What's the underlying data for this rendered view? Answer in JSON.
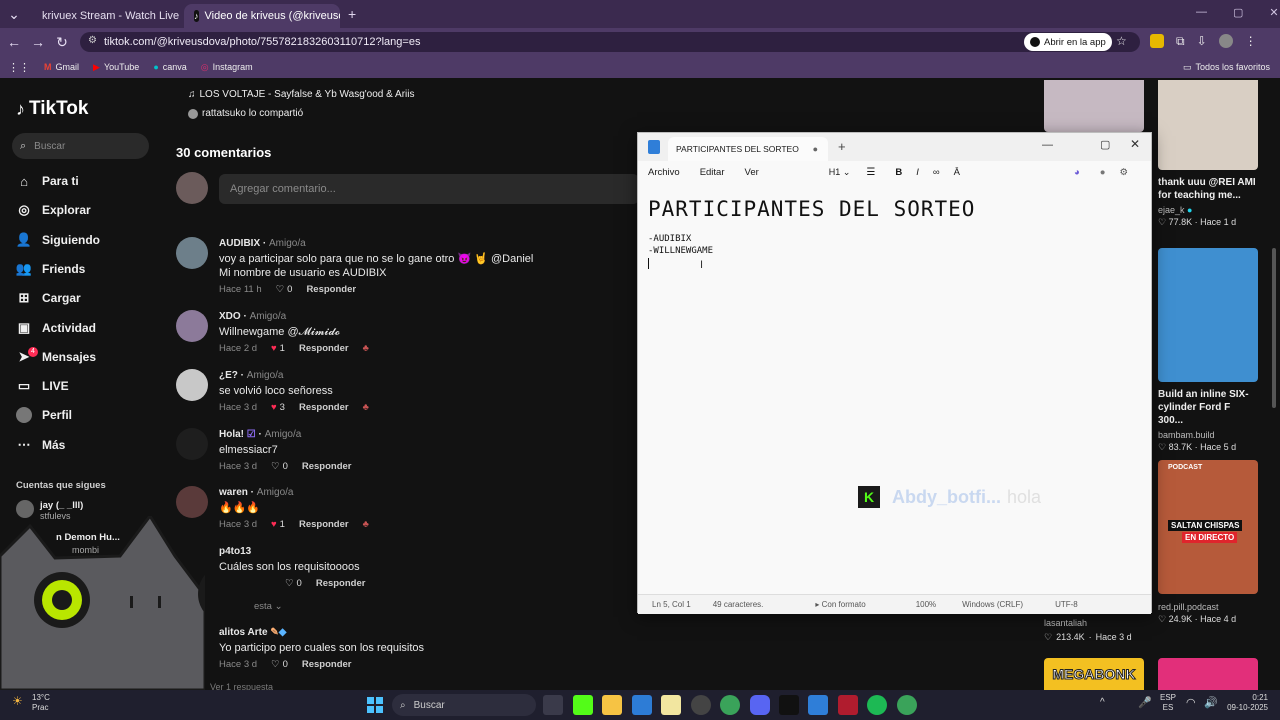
{
  "browser": {
    "tabs": [
      {
        "title": "krivuex Stream - Watch Live on",
        "active": false
      },
      {
        "title": "Video de kriveus (@kriveusdov",
        "active": true
      }
    ],
    "url": "tiktok.com/@kriveusdova/photo/7557821832603110712?lang=es",
    "open_in_app": "Abrir en la app",
    "bookmarks": [
      "Gmail",
      "YouTube",
      "canva",
      "Instagram"
    ],
    "all_favorites": "Todos los favoritos"
  },
  "sidebar": {
    "logo": "TikTok",
    "search_placeholder": "Buscar",
    "items": [
      {
        "label": "Para ti",
        "icon": "home-icon"
      },
      {
        "label": "Explorar",
        "icon": "compass-icon"
      },
      {
        "label": "Siguiendo",
        "icon": "following-icon"
      },
      {
        "label": "Friends",
        "icon": "friends-icon"
      },
      {
        "label": "Cargar",
        "icon": "upload-icon"
      },
      {
        "label": "Actividad",
        "icon": "activity-icon"
      },
      {
        "label": "Mensajes",
        "icon": "messages-icon",
        "badge": "4"
      },
      {
        "label": "LIVE",
        "icon": "live-icon"
      },
      {
        "label": "Perfil",
        "icon": "profile-icon"
      },
      {
        "label": "Más",
        "icon": "more-icon"
      }
    ],
    "following_title": "Cuentas que sigues",
    "following": [
      {
        "name": "jay (_ _lll)",
        "handle": "stfulevs"
      },
      {
        "name": "n Demon Hu...",
        "handle": "mombi"
      }
    ]
  },
  "video": {
    "music": "LOS VOLTAJE - Sayfalse & Yb Wasg'ood & Ariis",
    "shared_by": "rattatsuko lo compartió"
  },
  "comments": {
    "count_label": "30 comentarios",
    "add_placeholder": "Agregar comentario...",
    "reply_label": "Responder",
    "friend_label": "Amigo/a",
    "items": [
      {
        "user": "AUDIBIX",
        "friend": true,
        "text": "voy a participar solo para que no se lo gane otro 😈 🤘 @Daniel",
        "text2": "Mi nombre de usuario es AUDIBIX",
        "time": "Hace 11 h",
        "likes": "0",
        "liked": false
      },
      {
        "user": "XDO",
        "friend": true,
        "text": "Willnewgame @𝓜𝓲𝓶𝓲𝓭𝓸",
        "text2": "",
        "time": "Hace 2 d",
        "likes": "1",
        "liked": true
      },
      {
        "user": "¿E?",
        "friend": true,
        "text": "se volvió loco señoress",
        "text2": "",
        "time": "Hace 3 d",
        "likes": "3",
        "liked": true
      },
      {
        "user": "Hola!",
        "friend": true,
        "text": "elmessiacr7",
        "text2": "",
        "time": "Hace 3 d",
        "likes": "0",
        "liked": false
      },
      {
        "user": "waren",
        "friend": true,
        "text": "🔥🔥🔥",
        "text2": "",
        "time": "Hace 3 d",
        "likes": "1",
        "liked": true
      },
      {
        "user": "p4to13",
        "friend": false,
        "text": "Cuáles son los requisitoooos",
        "text2": "",
        "time": "",
        "likes": "0",
        "liked": false
      },
      {
        "user": "alitos Arte",
        "friend": false,
        "text": "Yo participo pero cuales son los requisitos",
        "text2": "",
        "time": "Hace 3 d",
        "likes": "0",
        "liked": false
      }
    ],
    "view_replies": "esta",
    "view_replies2": "Ver 1 respuesta"
  },
  "notepad": {
    "tab_title": "PARTICIPANTES DEL SORTEO",
    "menu": [
      "Archivo",
      "Editar",
      "Ver"
    ],
    "heading_level": "H1",
    "heading": "PARTICIPANTES DEL SORTEO",
    "lines": [
      "-AUDIBIX",
      "-WILLNEWGAME"
    ],
    "status": {
      "position": "Ln 5, Col 1",
      "chars": "49 caracteres.",
      "format": "Con formato",
      "zoom": "100%",
      "eol": "Windows (CRLF)",
      "encoding": "UTF-8"
    }
  },
  "overlay": {
    "bot_name": "Abdy_botfi...",
    "bot_msg": "hola"
  },
  "recommended": [
    {
      "caption": "thank uuu @REI AMI for teaching me...",
      "user": "ejae_k",
      "views": "77.8K",
      "time": "Hace 1 d",
      "color": "#d9cfc4"
    },
    {
      "caption": "Build an inline SIX-cylinder Ford F 300...",
      "user": "bambam.build",
      "views": "83.7K",
      "time": "Hace 5 d",
      "color": "#3f8fd0"
    },
    {
      "caption": "",
      "user": "red.pill.podcast",
      "views": "24.9K",
      "time": "Hace 4 d",
      "color": "#b65a3a"
    }
  ],
  "recommended_left": {
    "user": "lasantaliah",
    "views": "213.4K",
    "time": "Hace 3 d"
  },
  "thumb_labels": {
    "podcast": "PODCAST",
    "megabonk": "MEGABONK",
    "saltan": "SALTAN CHISPAS",
    "directo": "EN DIRECTO"
  },
  "taskbar": {
    "search": "Buscar",
    "lang": "ESP",
    "lang2": "ES",
    "time": "0:21",
    "date": "09-10-2025",
    "weather": "13°C",
    "weather2": "Prac"
  }
}
